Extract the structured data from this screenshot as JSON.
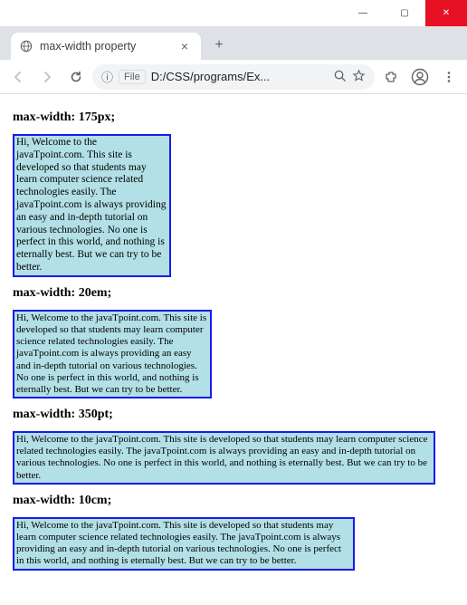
{
  "window": {
    "minimize": "—",
    "maximize": "▢",
    "close": "✕"
  },
  "tab": {
    "title": "max-width property",
    "close": "×",
    "newtab": "+"
  },
  "toolbar": {
    "file_label": "File",
    "info_icon": "ⓘ",
    "path": "D:/CSS/programs/Ex..."
  },
  "page": {
    "h1": "max-width: 175px;",
    "h2": "max-width: 20em;",
    "h3": "max-width: 350pt;",
    "h4": "max-width: 10cm;",
    "text": "Hi, Welcome to the javaTpoint.com. This site is developed so that students may learn computer science related technologies easily. The javaTpoint.com is always providing an easy and in-depth tutorial on various technologies. No one is perfect in this world, and nothing is eternally best. But we can try to be better."
  }
}
